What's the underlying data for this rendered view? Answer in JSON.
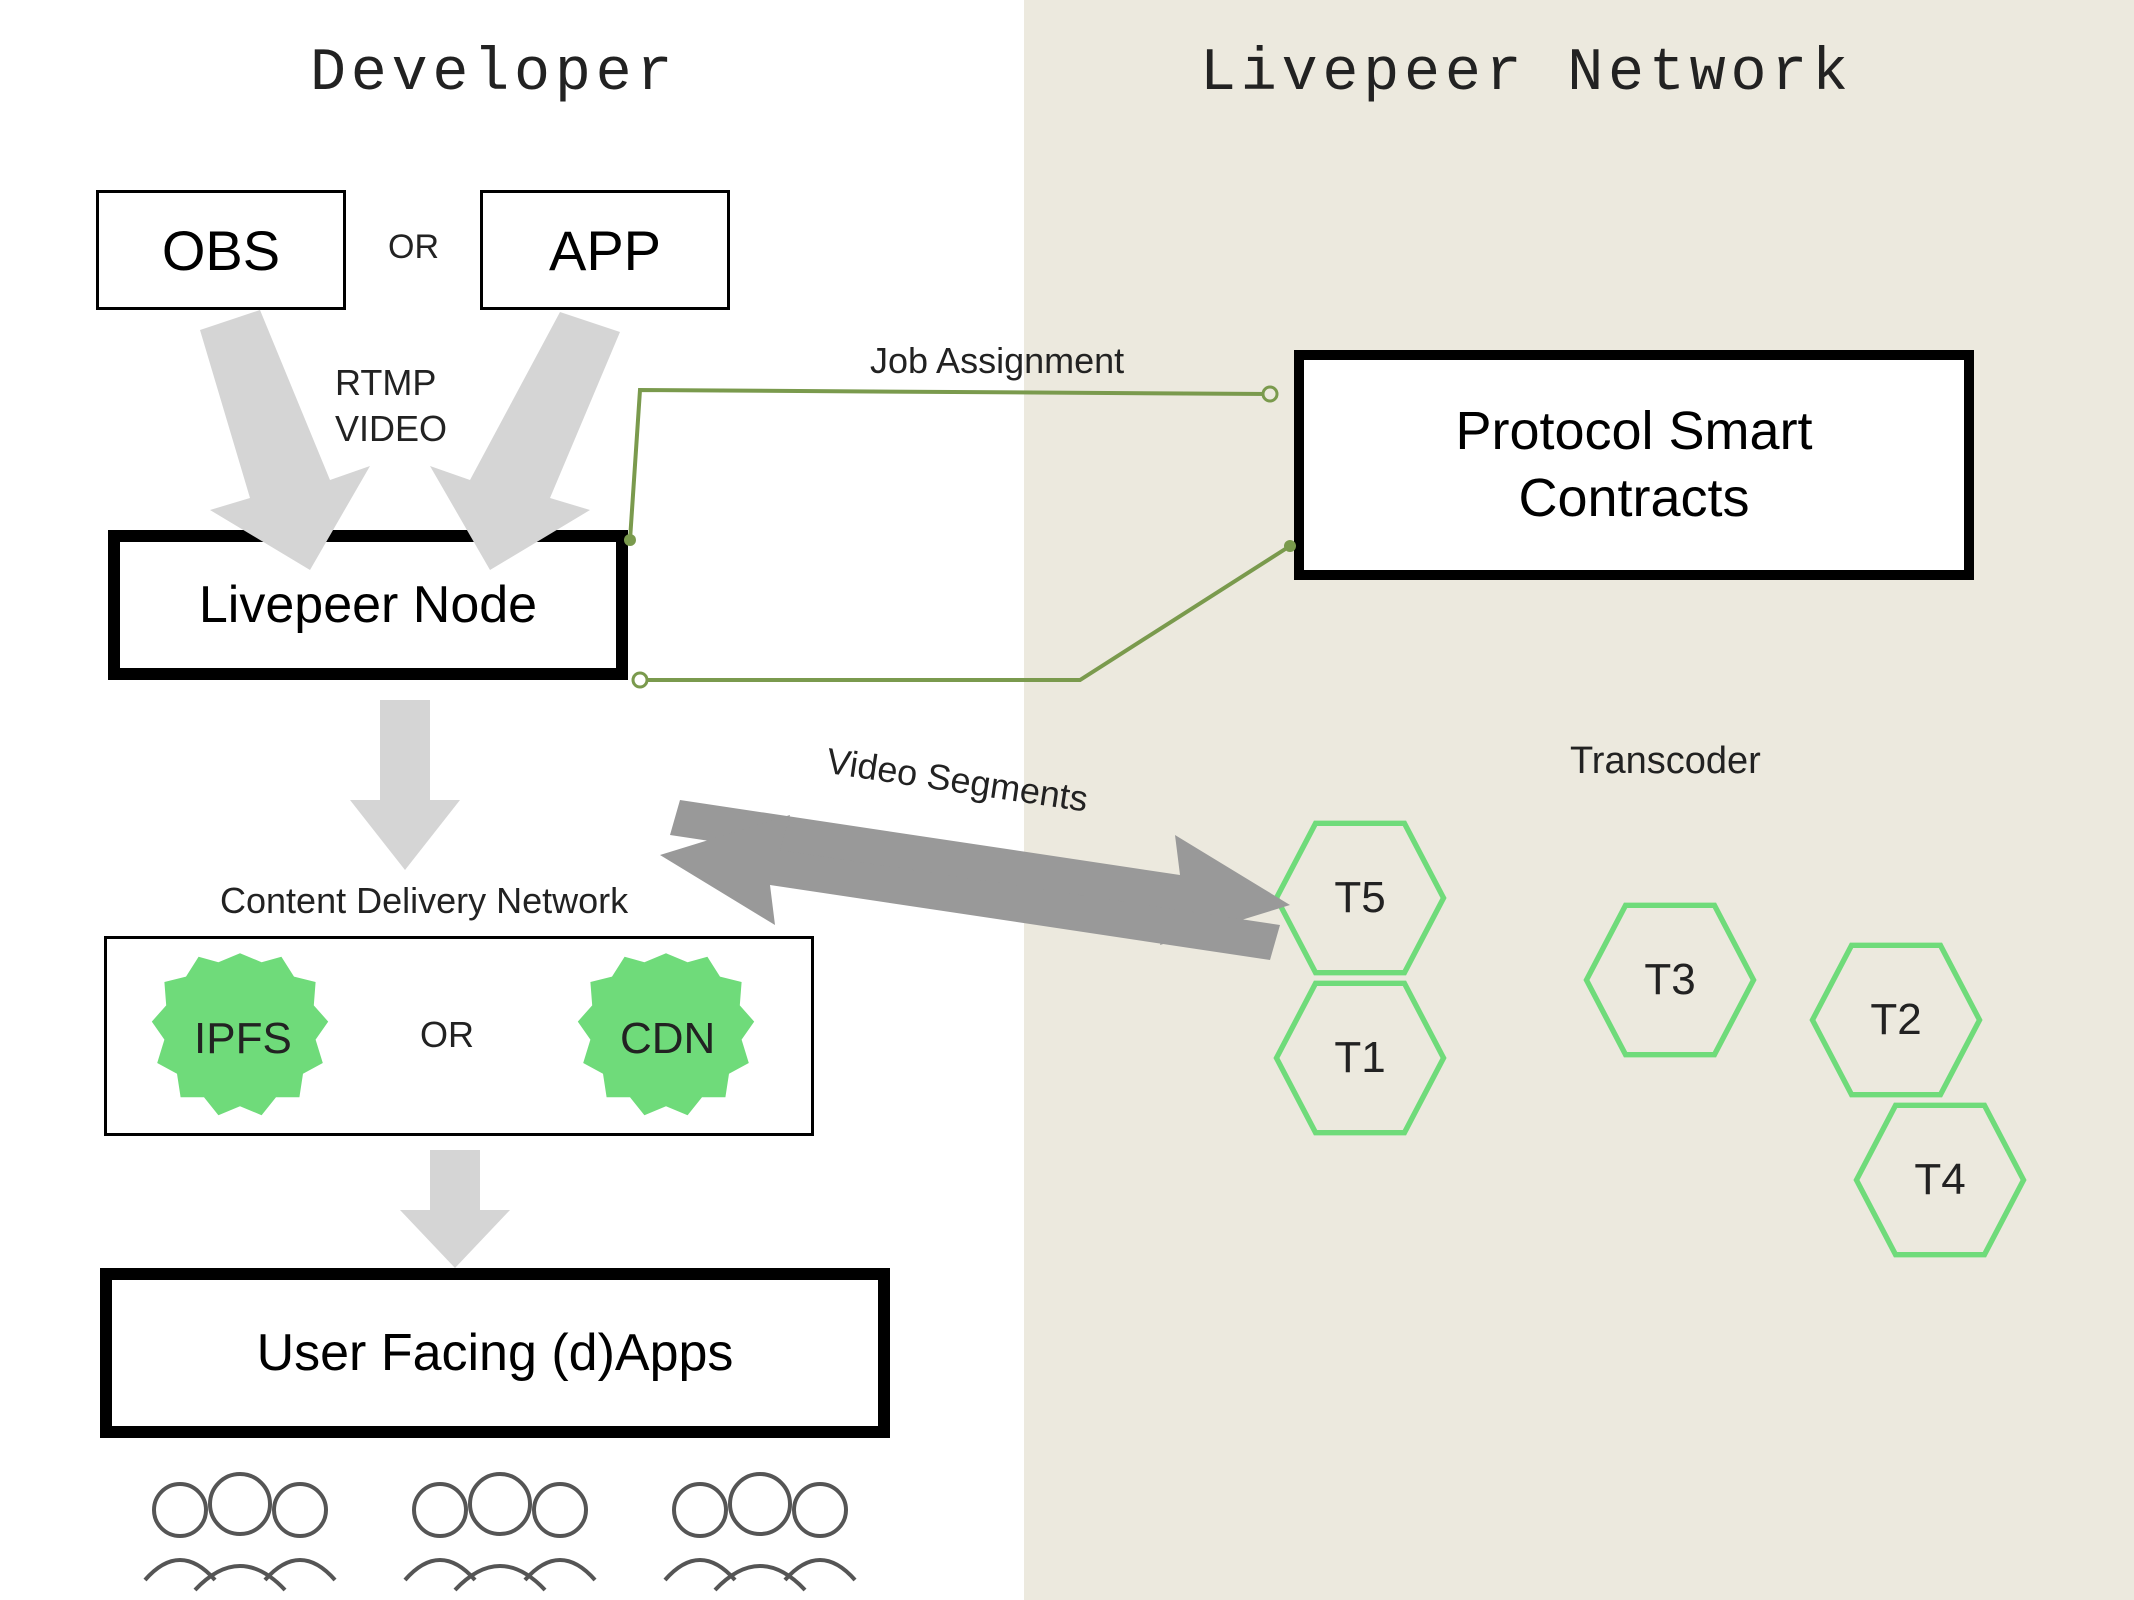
{
  "sections": {
    "developer": "Developer",
    "network": "Livepeer Network"
  },
  "boxes": {
    "obs": "OBS",
    "app": "APP",
    "or_top": "OR",
    "livepeer_node": "Livepeer Node",
    "protocol_smart_contracts_line1": "Protocol Smart",
    "protocol_smart_contracts_line2": "Contracts",
    "cdn_title": "Content Delivery Network",
    "ipfs": "IPFS",
    "cdn": "CDN",
    "or_cdn": "OR",
    "user_apps": "User Facing (d)Apps"
  },
  "labels": {
    "rtmp": "RTMP",
    "video": "VIDEO",
    "job_assignment": "Job Assignment",
    "video_segments": "Video Segments",
    "transcoder": "Transcoder"
  },
  "transcoders": {
    "t1": "T1",
    "t2": "T2",
    "t3": "T3",
    "t4": "T4",
    "t5": "T5"
  }
}
